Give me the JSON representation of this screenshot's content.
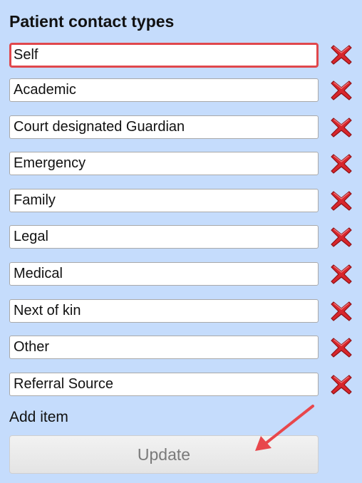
{
  "panel": {
    "title": "Patient contact types"
  },
  "contact_types": [
    {
      "value": "Self",
      "focused": true
    },
    {
      "value": "Academic"
    },
    {
      "value": "Court designated Guardian"
    },
    {
      "value": "Emergency"
    },
    {
      "value": "Family"
    },
    {
      "value": "Legal"
    },
    {
      "value": "Medical"
    },
    {
      "value": "Next of kin"
    },
    {
      "value": "Other"
    },
    {
      "value": "Referral Source"
    }
  ],
  "delete_icon": "red-x-delete-icon",
  "add_item_label": "Add item",
  "update_label": "Update",
  "colors": {
    "background": "#c5dcfc",
    "focus_border": "#e0474c",
    "delete_red": "#d8262c",
    "arrow": "#e8474c"
  }
}
